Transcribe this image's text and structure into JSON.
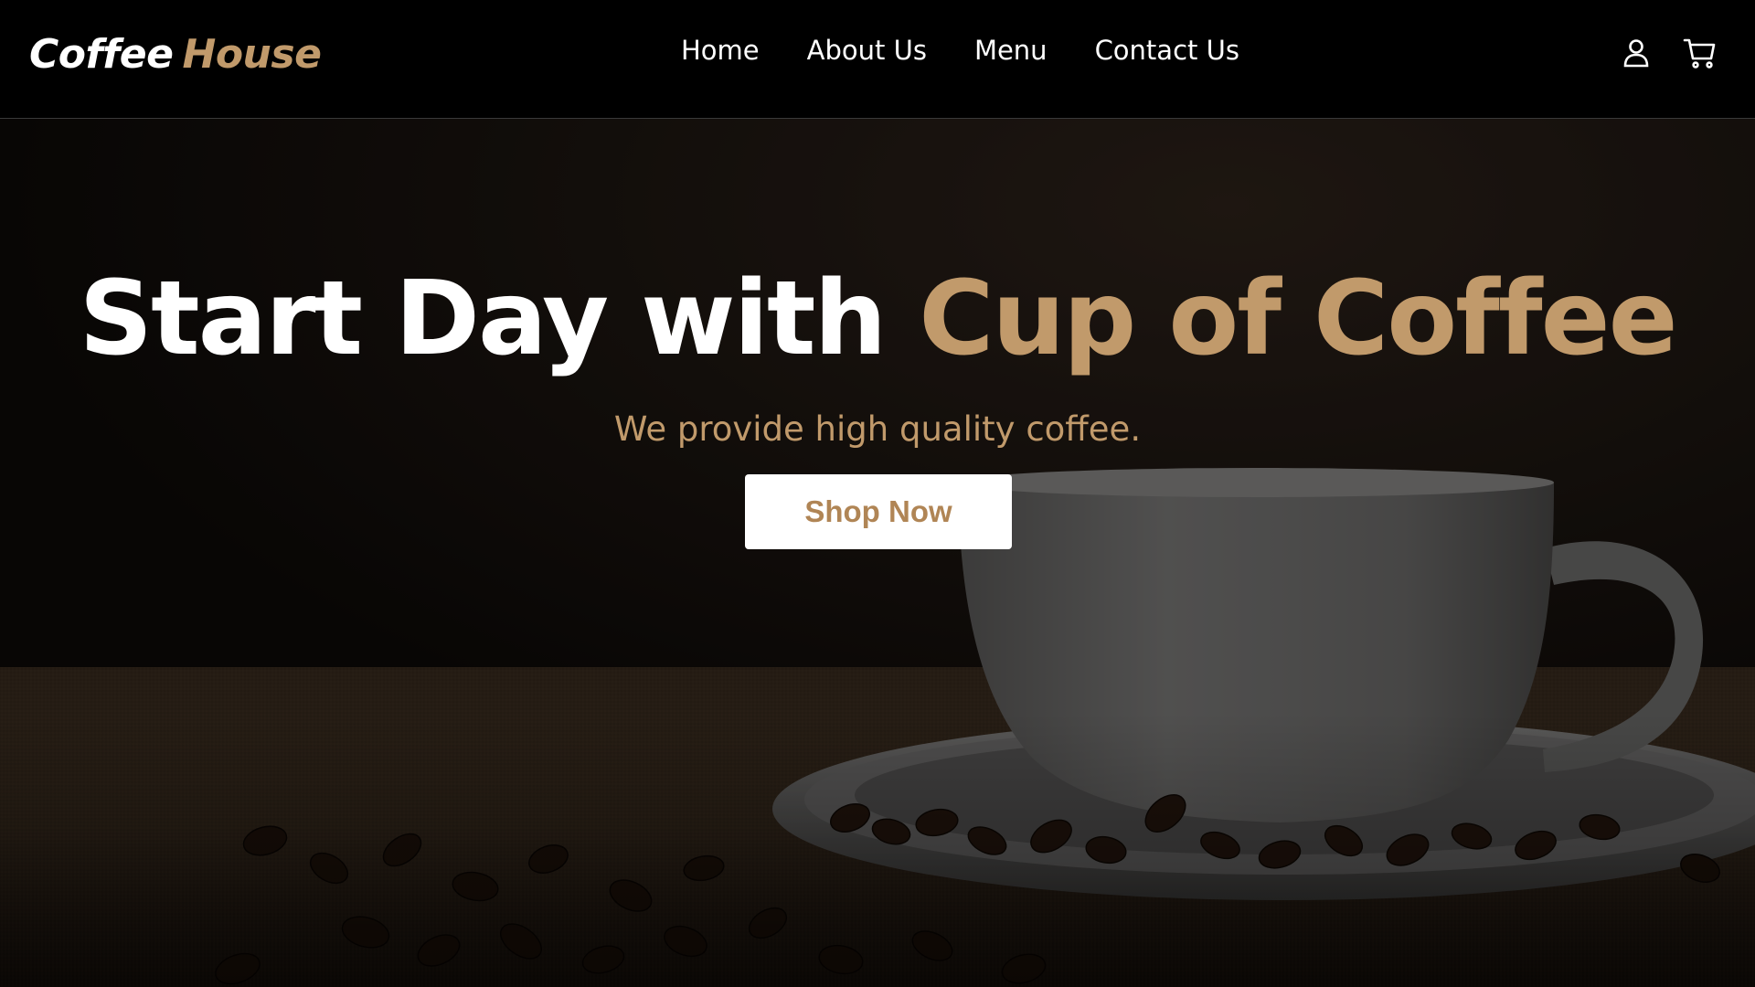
{
  "brand": {
    "name_first": "Coffee",
    "name_second": "House",
    "accent_color": "#c19a6b"
  },
  "nav": {
    "items": [
      {
        "label": "Home"
      },
      {
        "label": "About Us"
      },
      {
        "label": "Menu"
      },
      {
        "label": "Contact Us"
      }
    ]
  },
  "header_icons": [
    "user-icon",
    "cart-icon"
  ],
  "hero": {
    "title_white": "Start Day with",
    "title_accent": "Cup of Coffee",
    "subtitle": "We provide high quality coffee.",
    "cta_label": "Shop Now",
    "background": "coffee cup on saucer with coffee beans on burlap"
  }
}
